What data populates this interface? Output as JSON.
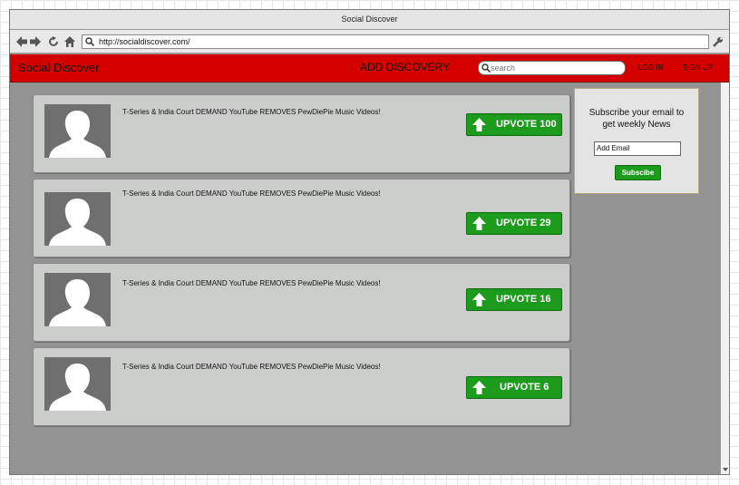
{
  "window": {
    "title": "Social Discover"
  },
  "browser": {
    "url": "http://socialdiscover.com/"
  },
  "appbar": {
    "brand": "Social Discover",
    "add_discovery": "ADD DISCOVERY",
    "search_placeholder": "search",
    "login": "LOG IN",
    "signup": "SIGN UP"
  },
  "posts": [
    {
      "title": "T-Series & India Court DEMAND YouTube REMOVES PewDiePie Music Videos!",
      "upvote_label": "UPVOTE 100"
    },
    {
      "title": "T-Series & India Court DEMAND YouTube REMOVES PewDiePie Music Videos!",
      "upvote_label": "UPVOTE 29"
    },
    {
      "title": "T-Series & India Court DEMAND YouTube REMOVES PewDiePie Music Videos!",
      "upvote_label": "UPVOTE 16"
    },
    {
      "title": "T-Series & India Court DEMAND YouTube REMOVES PewDiePie Music Videos!",
      "upvote_label": "UPVOTE 6"
    }
  ],
  "sidebar": {
    "title_line1": "Subscribe your email to",
    "title_line2": "get  weekly News",
    "email_value": "Add Email",
    "subscribe_label": "Subscibe"
  },
  "icons": [
    "back-icon",
    "forward-icon",
    "refresh-icon",
    "home-icon",
    "search-icon",
    "wrench-icon",
    "upvote-arrow-icon",
    "avatar-icon",
    "scroll-down-icon"
  ],
  "colors": {
    "appbar": "#d40000",
    "upvote_green": "#1c9b1c",
    "page_bg": "#939393",
    "card_bg": "#cbcdcb"
  }
}
